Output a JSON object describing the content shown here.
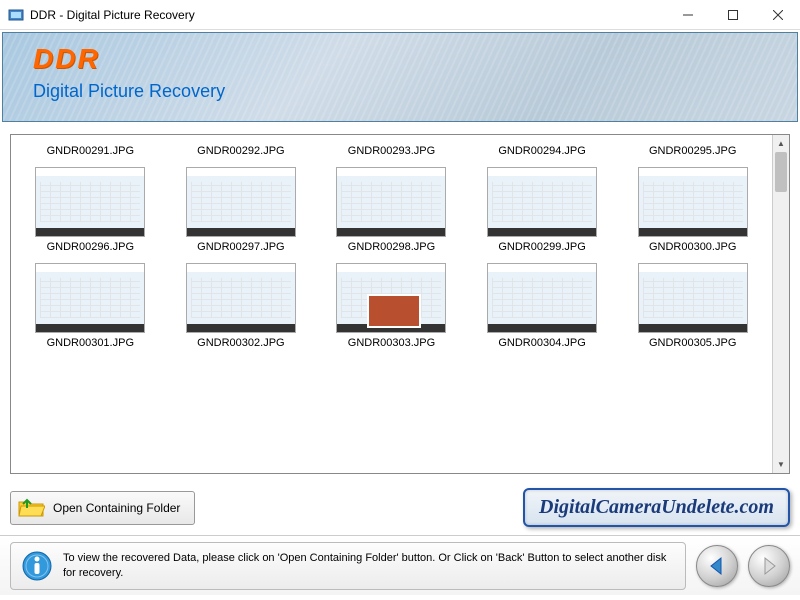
{
  "window": {
    "title": "DDR - Digital Picture Recovery"
  },
  "header": {
    "logo": "DDR",
    "subtitle": "Digital Picture Recovery"
  },
  "thumbnails": {
    "row1": [
      {
        "name": "GNDR00291.JPG"
      },
      {
        "name": "GNDR00292.JPG"
      },
      {
        "name": "GNDR00293.JPG"
      },
      {
        "name": "GNDR00294.JPG"
      },
      {
        "name": "GNDR00295.JPG"
      }
    ],
    "row2": [
      {
        "name": "GNDR00296.JPG"
      },
      {
        "name": "GNDR00297.JPG"
      },
      {
        "name": "GNDR00298.JPG"
      },
      {
        "name": "GNDR00299.JPG"
      },
      {
        "name": "GNDR00300.JPG"
      }
    ],
    "row3": [
      {
        "name": "GNDR00301.JPG"
      },
      {
        "name": "GNDR00302.JPG"
      },
      {
        "name": "GNDR00303.JPG"
      },
      {
        "name": "GNDR00304.JPG"
      },
      {
        "name": "GNDR00305.JPG"
      }
    ]
  },
  "toolbar": {
    "open_folder_label": "Open Containing Folder",
    "website": "DigitalCameraUndelete.com"
  },
  "footer": {
    "info_text": "To view the recovered Data, please click on 'Open Containing Folder' button. Or Click on 'Back' Button to select another disk for recovery."
  }
}
